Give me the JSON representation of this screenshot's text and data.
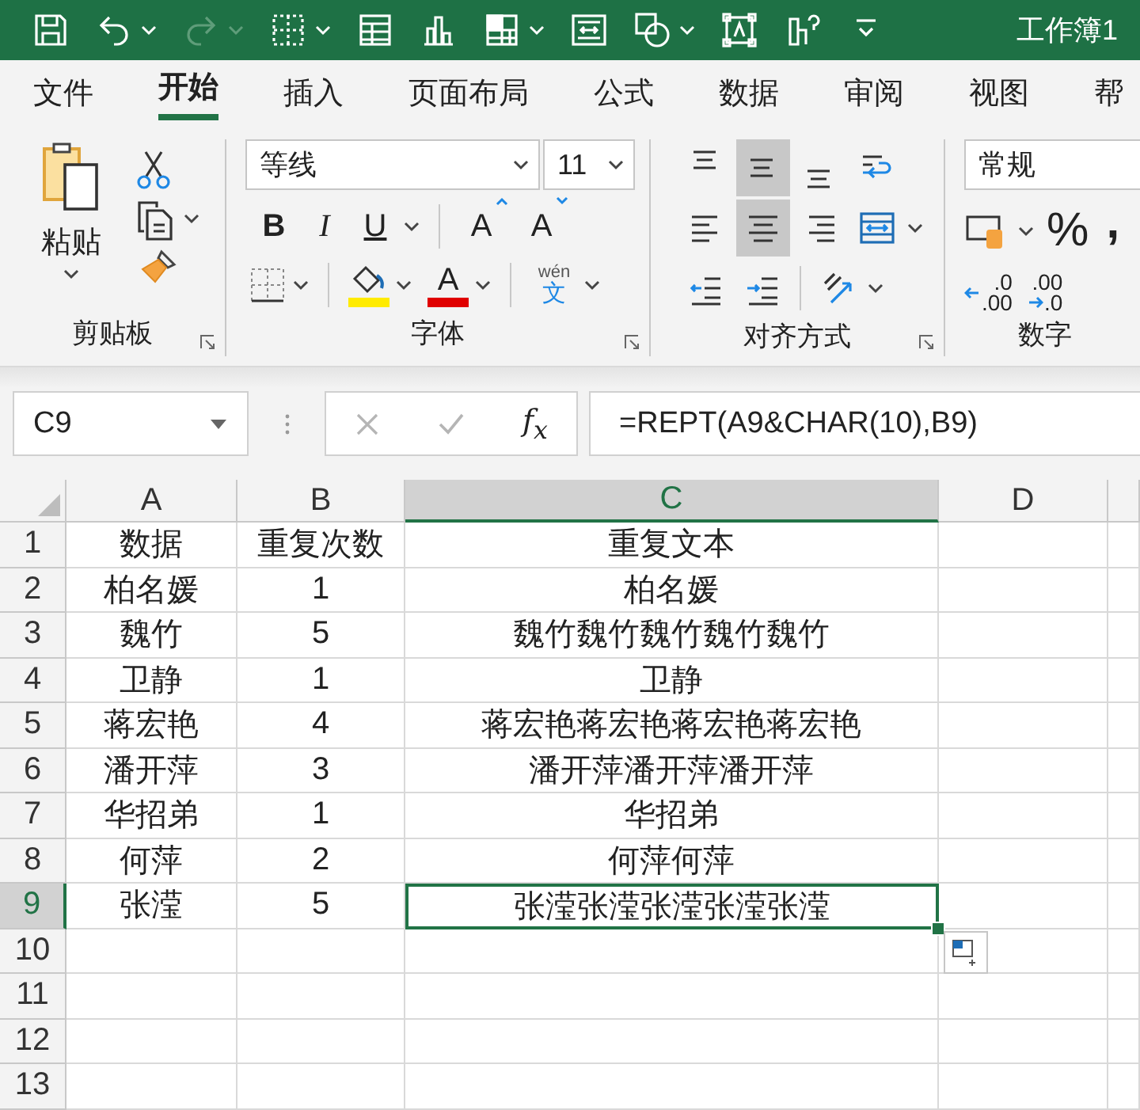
{
  "title_bar": {
    "quick_access": [
      {
        "kind": "save",
        "disabled": false
      },
      {
        "kind": "undo",
        "disabled": false
      },
      {
        "kind": "redo",
        "disabled": true
      },
      {
        "kind": "borders",
        "disabled": false
      },
      {
        "kind": "form",
        "disabled": false
      },
      {
        "kind": "chart",
        "disabled": false
      },
      {
        "kind": "table",
        "disabled": false
      },
      {
        "kind": "frame",
        "disabled": false
      },
      {
        "kind": "shapes",
        "disabled": false
      },
      {
        "kind": "textbox",
        "disabled": false
      },
      {
        "kind": "bars",
        "disabled": false
      },
      {
        "kind": "customize",
        "disabled": false
      }
    ],
    "title": "工作簿1"
  },
  "tabs": [
    {
      "label": "文件",
      "selected": false
    },
    {
      "label": "开始",
      "selected": true
    },
    {
      "label": "插入",
      "selected": false
    },
    {
      "label": "页面布局",
      "selected": false
    },
    {
      "label": "公式",
      "selected": false
    },
    {
      "label": "数据",
      "selected": false
    },
    {
      "label": "审阅",
      "selected": false
    },
    {
      "label": "视图",
      "selected": false
    },
    {
      "label": "帮",
      "selected": false
    }
  ],
  "ribbon": {
    "clipboard": {
      "label": "剪贴板",
      "paste": "粘贴"
    },
    "font": {
      "label": "字体",
      "font_name": "等线",
      "font_size": "11",
      "bold": "B",
      "italic": "I",
      "underline": "U",
      "grow": "A",
      "shrink": "A",
      "font_color": "A",
      "phonetic": {
        "top": "wén",
        "bottom": "文"
      }
    },
    "alignment": {
      "label": "对齐方式",
      "rows": [
        {
          "buttons": [
            {
              "kind": "align-top",
              "selected": false
            },
            {
              "kind": "align-middle",
              "selected": true
            },
            {
              "kind": "align-bottom",
              "selected": false
            },
            {
              "kind": "wrap-text",
              "selected": false
            }
          ]
        },
        {
          "buttons": [
            {
              "kind": "align-left",
              "selected": false
            },
            {
              "kind": "align-center",
              "selected": true
            },
            {
              "kind": "align-right",
              "selected": false
            },
            {
              "kind": "merge",
              "selected": false
            }
          ]
        },
        {
          "buttons": [
            {
              "kind": "indent-decrease",
              "selected": false
            },
            {
              "kind": "indent-increase",
              "selected": false
            },
            {
              "kind": "orientation",
              "selected": false
            }
          ]
        }
      ]
    },
    "number": {
      "label": "数字",
      "format": "常规",
      "percent": "%",
      "comma": ",",
      "increase_decimal": {
        "top": ".0",
        "bottom": ".00"
      },
      "decrease_decimal": {
        "top": ".00",
        "bottom": ".0"
      }
    }
  },
  "formula_bar": {
    "name_box": "C9",
    "fx": "f$_{x}$",
    "formula": "=REPT(A9&CHAR(10),B9)"
  },
  "sheet": {
    "columns": [
      {
        "label": "A",
        "selected": false
      },
      {
        "label": "B",
        "selected": false
      },
      {
        "label": "C",
        "selected": true
      },
      {
        "label": "D",
        "selected": false
      }
    ],
    "rows": [
      {
        "label": "1",
        "selected": false,
        "cells": [
          {
            "text": "数据",
            "selected": false
          },
          {
            "text": "重复次数",
            "selected": false
          },
          {
            "text": "重复文本",
            "selected": false
          }
        ]
      },
      {
        "label": "2",
        "selected": false,
        "cells": [
          {
            "text": "柏名媛",
            "selected": false
          },
          {
            "text": "1",
            "selected": false
          },
          {
            "text": "柏名媛",
            "selected": false
          }
        ]
      },
      {
        "label": "3",
        "selected": false,
        "cells": [
          {
            "text": "魏竹",
            "selected": false
          },
          {
            "text": "5",
            "selected": false
          },
          {
            "text": "魏竹魏竹魏竹魏竹魏竹",
            "selected": false
          }
        ]
      },
      {
        "label": "4",
        "selected": false,
        "cells": [
          {
            "text": "卫静",
            "selected": false
          },
          {
            "text": "1",
            "selected": false
          },
          {
            "text": "卫静",
            "selected": false
          }
        ]
      },
      {
        "label": "5",
        "selected": false,
        "cells": [
          {
            "text": "蒋宏艳",
            "selected": false
          },
          {
            "text": "4",
            "selected": false
          },
          {
            "text": "蒋宏艳蒋宏艳蒋宏艳蒋宏艳",
            "selected": false
          }
        ]
      },
      {
        "label": "6",
        "selected": false,
        "cells": [
          {
            "text": "潘开萍",
            "selected": false
          },
          {
            "text": "3",
            "selected": false
          },
          {
            "text": "潘开萍潘开萍潘开萍",
            "selected": false
          }
        ]
      },
      {
        "label": "7",
        "selected": false,
        "cells": [
          {
            "text": "华招弟",
            "selected": false
          },
          {
            "text": "1",
            "selected": false
          },
          {
            "text": "华招弟",
            "selected": false
          }
        ]
      },
      {
        "label": "8",
        "selected": false,
        "cells": [
          {
            "text": "何萍",
            "selected": false
          },
          {
            "text": "2",
            "selected": false
          },
          {
            "text": "何萍何萍",
            "selected": false
          }
        ]
      },
      {
        "label": "9",
        "selected": true,
        "cells": [
          {
            "text": "张滢",
            "selected": false
          },
          {
            "text": "5",
            "selected": false
          },
          {
            "text": "张滢张滢张滢张滢张滢",
            "selected": true
          }
        ]
      },
      {
        "label": "10",
        "selected": false
      },
      {
        "label": "11",
        "selected": false
      },
      {
        "label": "12",
        "selected": false
      },
      {
        "label": "13",
        "selected": false
      }
    ]
  }
}
